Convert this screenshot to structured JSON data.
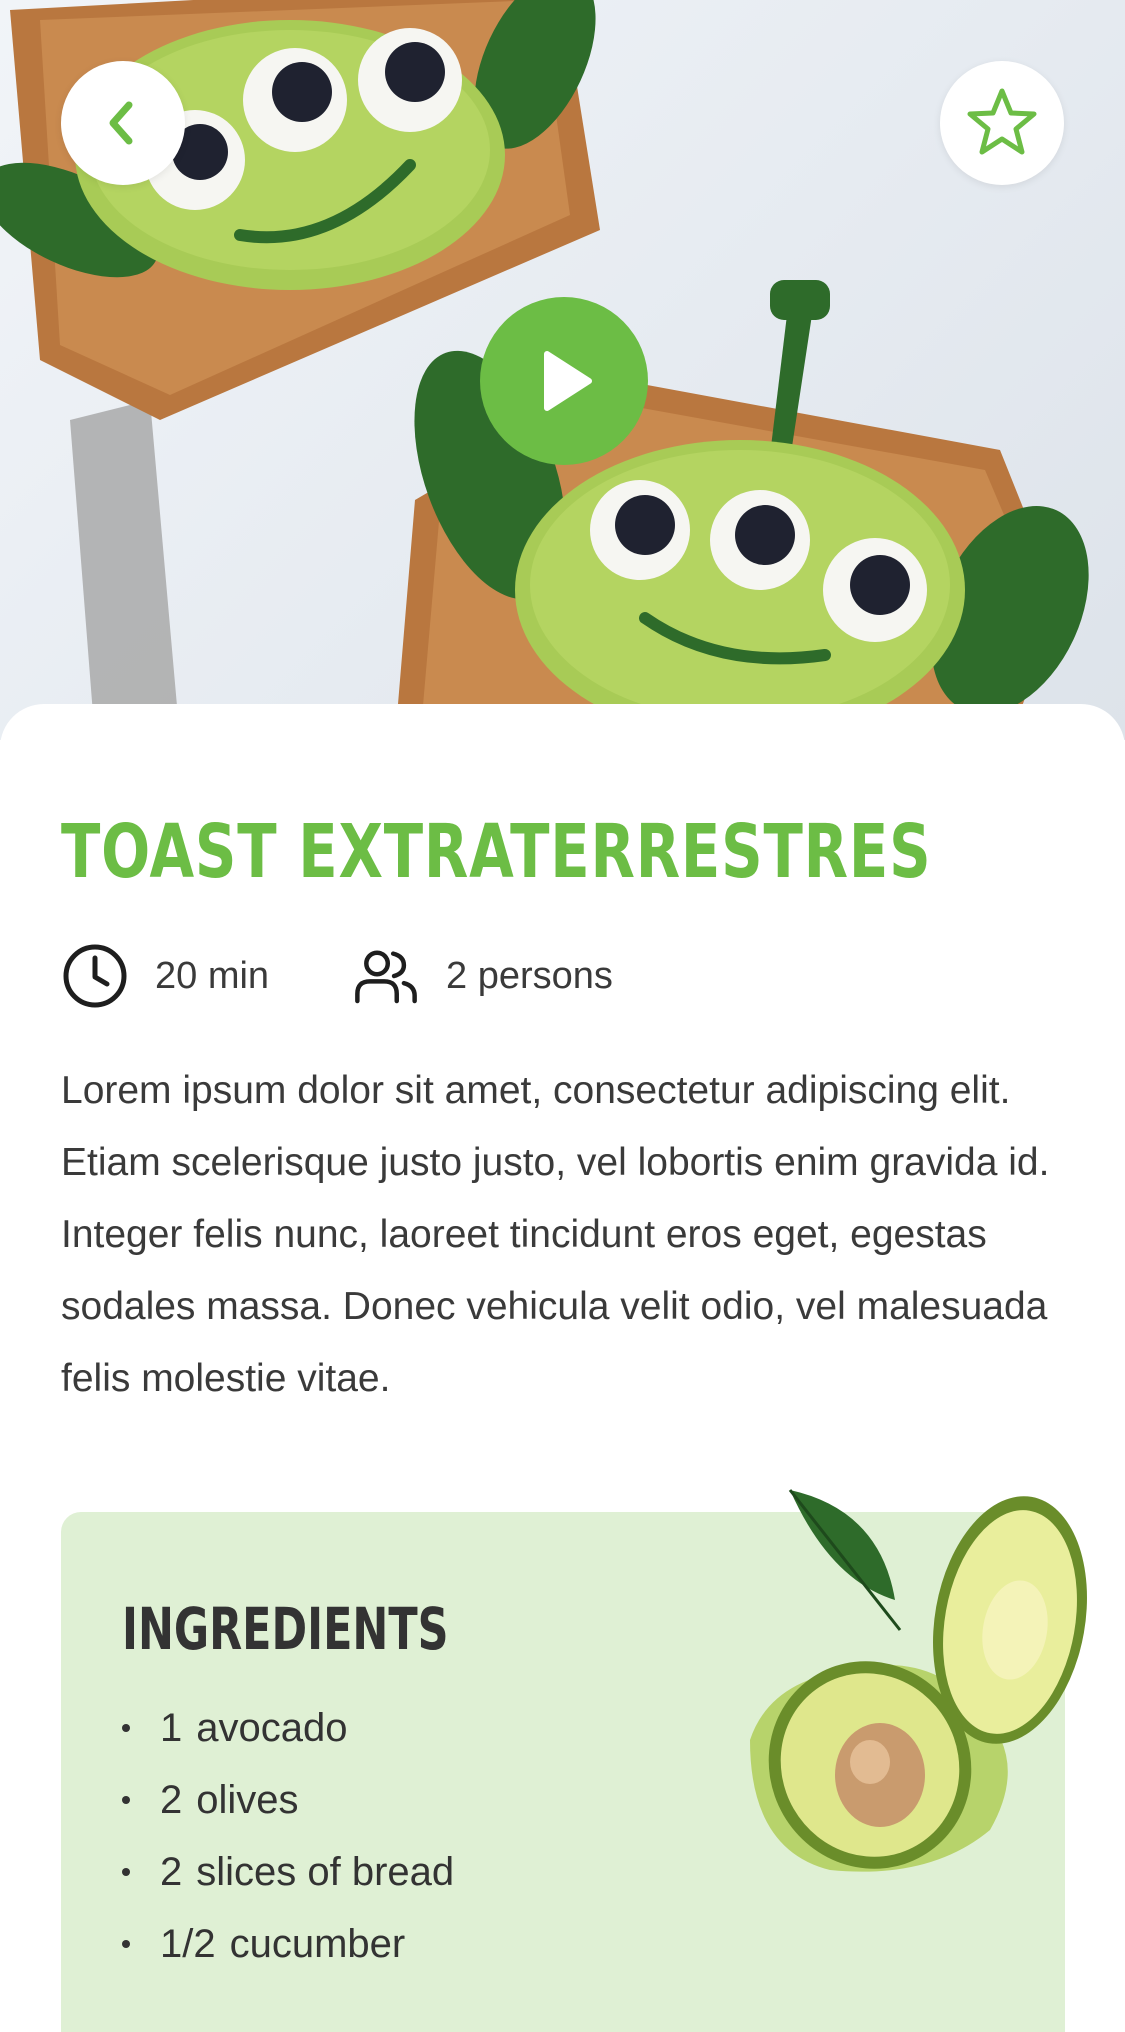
{
  "hero": {
    "back_icon": "chevron-left-icon",
    "favorite_icon": "star-outline-icon",
    "play_icon": "play-icon"
  },
  "recipe": {
    "title": "TOAST EXTRATERRESTRES",
    "time": "20 min",
    "servings": "2 persons",
    "description": "Lorem ipsum dolor sit amet, consectetur adipiscing elit. Etiam scelerisque justo justo, vel lobortis enim gravida id. Integer felis nunc, laoreet tincidunt eros eget, egestas sodales massa. Donec vehicula velit odio, vel malesuada felis molestie vitae."
  },
  "ingredients": {
    "title": "INGREDIENTS",
    "items": [
      {
        "qty": "1",
        "name": "avocado"
      },
      {
        "qty": "2",
        "name": "olives"
      },
      {
        "qty": "2",
        "name": "slices of bread"
      },
      {
        "qty": "1/2",
        "name": "cucumber"
      }
    ]
  },
  "colors": {
    "accent": "#6cbd45",
    "ingredients_bg": "#dff0d4",
    "text": "#3a3a3a"
  }
}
